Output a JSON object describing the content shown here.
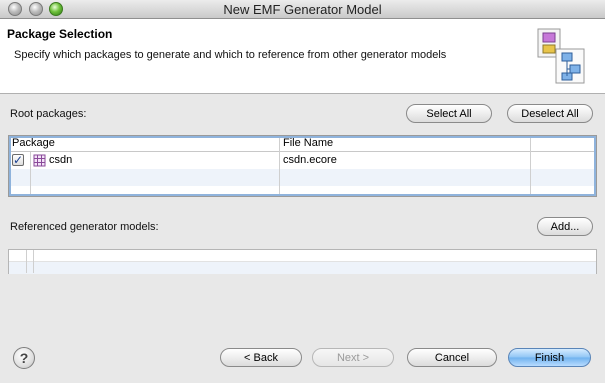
{
  "window": {
    "title": "New EMF Generator Model"
  },
  "banner": {
    "title": "Package Selection",
    "description": "Specify which packages to generate and which to reference from other generator models",
    "icon": "wizard-diagram-icon"
  },
  "root_packages": {
    "label": "Root packages:",
    "select_all": "Select All",
    "deselect_all": "Deselect All",
    "columns": [
      "Package",
      "File Name"
    ],
    "rows": [
      {
        "checked": true,
        "package": "csdn",
        "file_name": "csdn.ecore",
        "icon": "package-icon"
      }
    ]
  },
  "referenced": {
    "label": "Referenced generator models:",
    "add": "Add..."
  },
  "footer": {
    "help_glyph": "?",
    "back": "< Back",
    "next": "Next >",
    "cancel": "Cancel",
    "finish": "Finish"
  },
  "colors": {
    "selection_border": "#8fb3dc",
    "default_button": "#6fb1ee",
    "alt_row": "#eef3fa"
  }
}
